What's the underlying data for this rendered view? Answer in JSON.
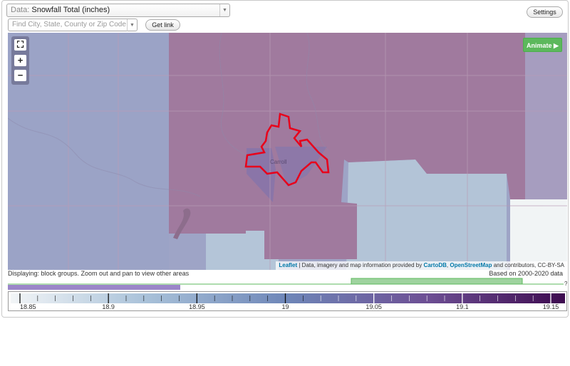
{
  "controls": {
    "data_label": "Data:",
    "data_value": "Snowfall Total (inches)",
    "search_placeholder": "Find City, State, County or Zip Code",
    "get_link": "Get link",
    "settings": "Settings"
  },
  "map": {
    "animate_label": "Animate ▶",
    "zoom_in": "+",
    "zoom_out": "−",
    "city_label": "Carroll",
    "attribution": {
      "leaflet": "Leaflet",
      "text1": " | Data, imagery and map information provided by ",
      "cartodb": "CartoDB",
      "comma": ", ",
      "osm": "OpenStreetMap",
      "text2": " and contributors, CC-BY-SA"
    }
  },
  "info": {
    "displaying": "Displaying: block groups. Zoom out and pan to view other areas",
    "based_on": "Based on 2000-2020 data",
    "histogram_marker": "?"
  },
  "legend": {
    "ticks": [
      "18.85",
      "18.9",
      "18.95",
      "19",
      "19.05",
      "19.1",
      "19.15"
    ],
    "color_low": "#f2f5f7",
    "color_high": "#3d0a4f"
  },
  "colors": {
    "map_low": "#b4c6d8",
    "map_mid": "#9fa6c8",
    "map_high": "#a27a9e",
    "boundary": "#e8001b",
    "accent": "#5cb85c"
  }
}
